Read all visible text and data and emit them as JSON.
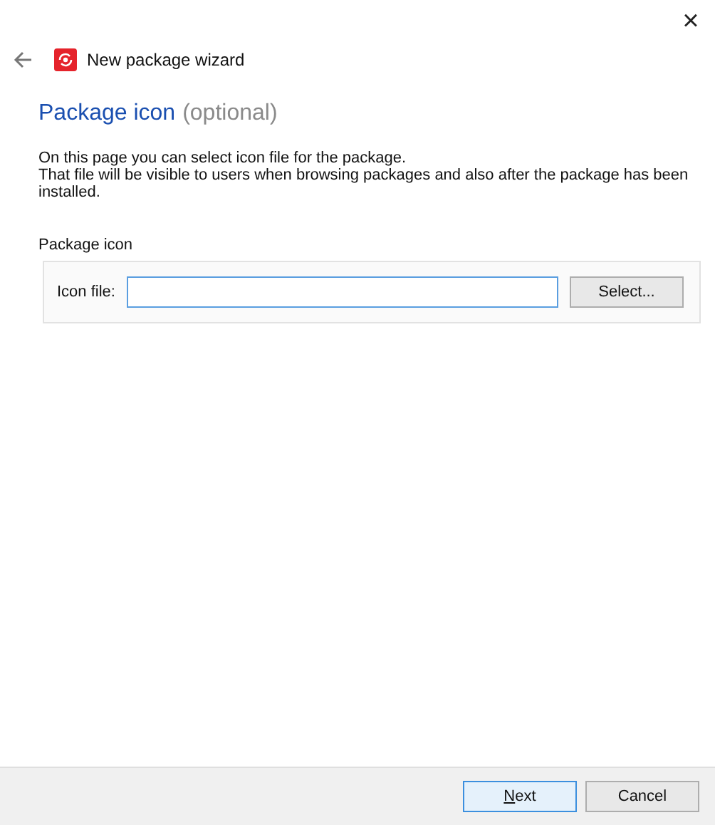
{
  "window": {
    "close_label": "×"
  },
  "header": {
    "title": "New package wizard"
  },
  "page": {
    "heading": "Package icon",
    "heading_note": "(optional)",
    "description": [
      "On this page you can select icon file for the package.",
      "That file will be visible to users when browsing packages and also after the package has been installed."
    ]
  },
  "group": {
    "label": "Package icon",
    "field_label": "Icon file:",
    "focused": true,
    "button": "Select..."
  },
  "footer": {
    "buttons": [
      {
        "label": "Next",
        "kind": "primary",
        "access_key_underlined": true
      },
      {
        "label": "Cancel",
        "kind": "normal",
        "access_key_underlined": false
      }
    ]
  }
}
